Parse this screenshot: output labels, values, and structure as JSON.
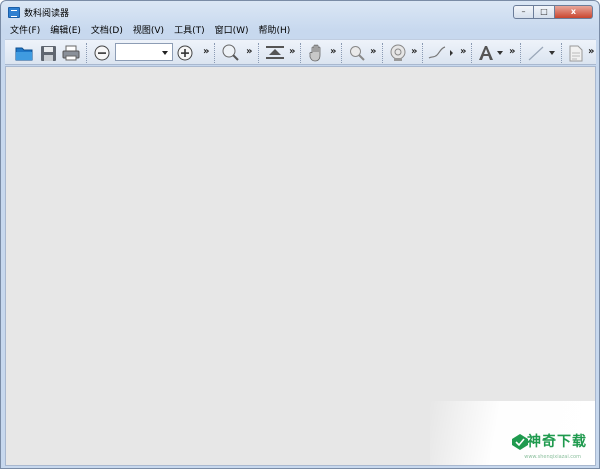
{
  "window": {
    "title": "数科阅读器",
    "icon": "app-icon",
    "controls": {
      "minimize": "–",
      "maximize": "□",
      "close": "x"
    }
  },
  "menubar": {
    "items": [
      "文件(F)",
      "编辑(E)",
      "文档(D)",
      "视图(V)",
      "工具(T)",
      "窗口(W)",
      "帮助(H)"
    ]
  },
  "toolbar": {
    "chevron": "»",
    "zoom": {
      "value": ""
    },
    "icons": [
      "open-icon",
      "save-icon",
      "print-icon",
      "zoom-out-icon",
      "zoom-in-icon",
      "magnifier-icon",
      "fit-page-icon",
      "hand-icon",
      "find-icon",
      "stamp-icon",
      "pen-icon",
      "text-icon",
      "line-icon",
      "note-icon"
    ]
  },
  "watermark": {
    "text": "神奇下载",
    "url": "www.shenqixiazai.com"
  },
  "colors": {
    "client_bg": "#e7e7e7",
    "titlebar": "#c7d8ee",
    "accent": "#1f9a4e"
  }
}
